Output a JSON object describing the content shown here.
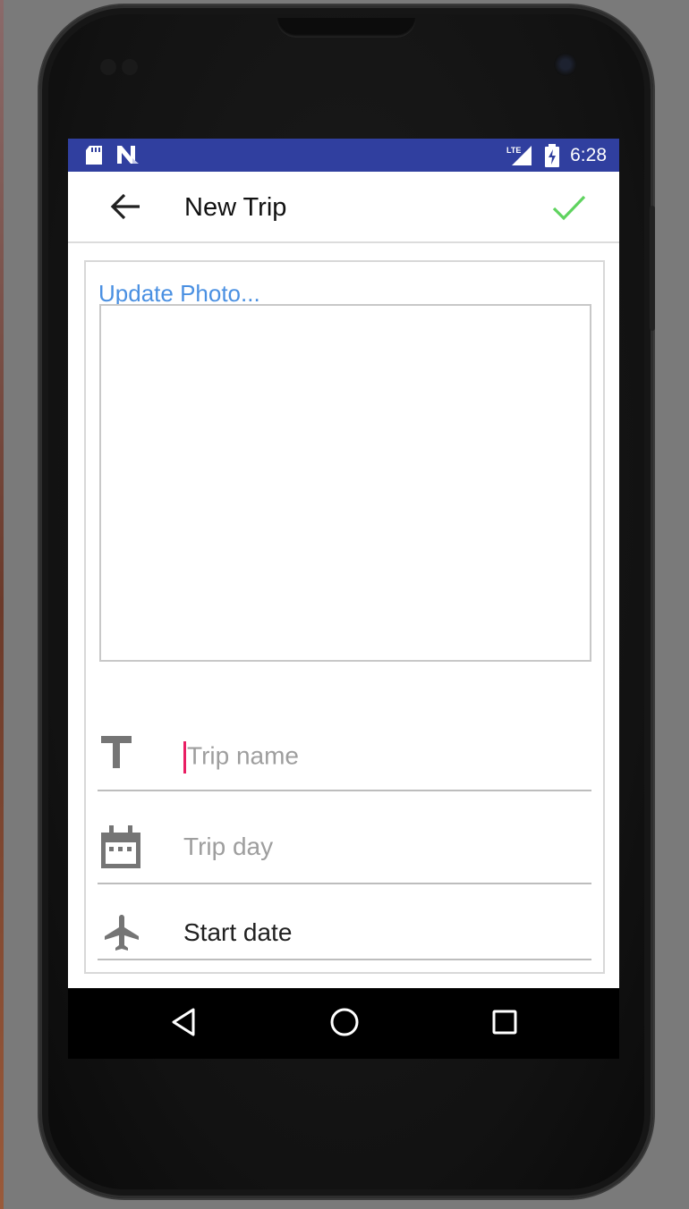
{
  "status_bar": {
    "time": "6:28",
    "left_icons": [
      "sd-card-icon",
      "n-notification-icon"
    ],
    "right_icons": [
      "lte-signal-icon",
      "battery-icon"
    ],
    "signal_label": "LTE",
    "color": "#303f9f"
  },
  "app_bar": {
    "title": "New Trip",
    "back_icon": "arrow-back-icon",
    "confirm_icon": "check-icon",
    "confirm_color": "#5fd35f"
  },
  "form": {
    "update_photo_label": "Update Photo...",
    "fields": [
      {
        "icon": "title-t-icon",
        "placeholder": "Trip name",
        "value": "",
        "focused": true
      },
      {
        "icon": "calendar-icon",
        "placeholder": "Trip day",
        "value": ""
      },
      {
        "icon": "airplane-icon",
        "placeholder": "",
        "value": "Start date"
      }
    ]
  },
  "nav_bar": {
    "buttons": [
      "back-triangle-icon",
      "home-circle-icon",
      "recents-square-icon"
    ]
  },
  "colors": {
    "link": "#4a90e2",
    "cursor": "#e91e63",
    "icon_gray": "#757575"
  }
}
